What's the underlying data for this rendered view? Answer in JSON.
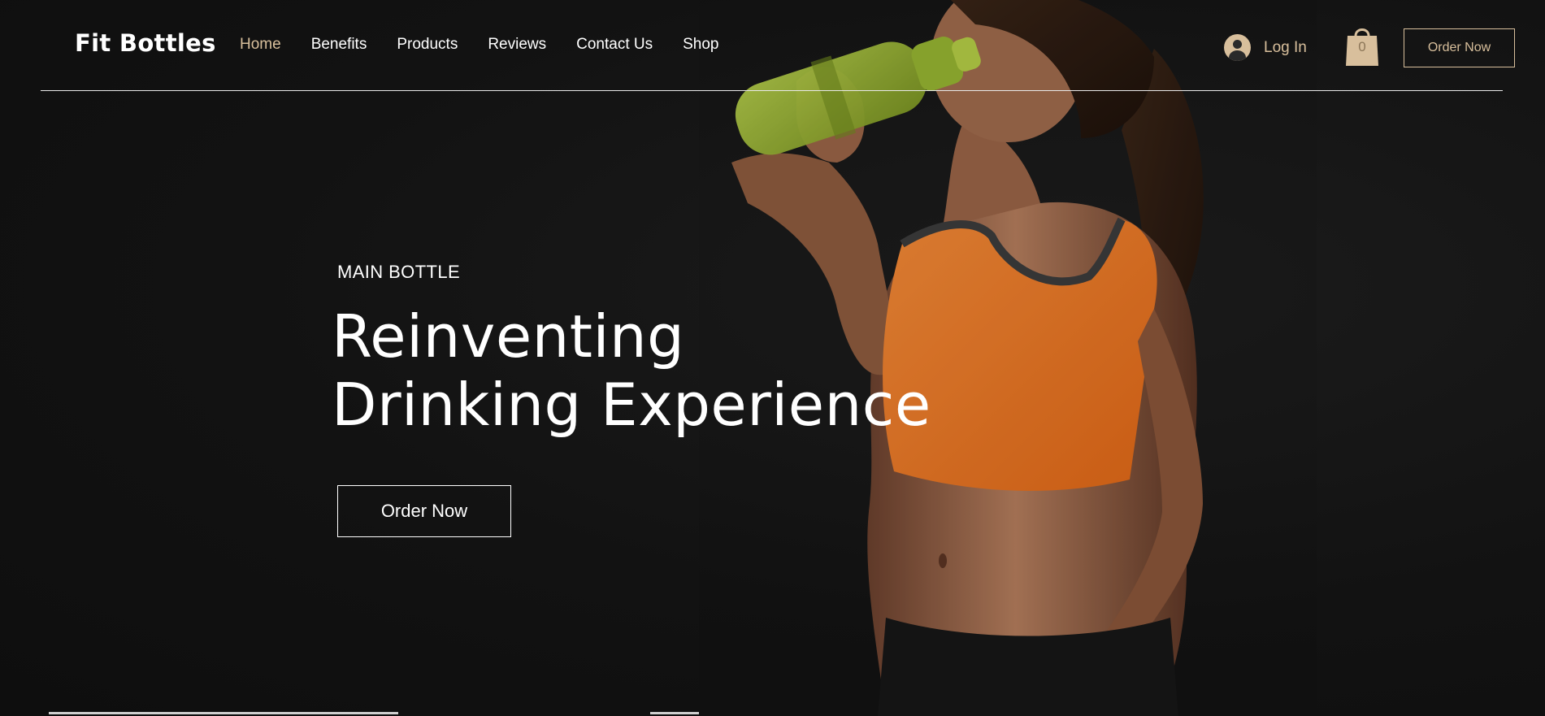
{
  "header": {
    "logo": "Fit Bottles",
    "nav": [
      {
        "label": "Home",
        "active": true
      },
      {
        "label": "Benefits"
      },
      {
        "label": "Products"
      },
      {
        "label": "Reviews"
      },
      {
        "label": "Contact Us"
      },
      {
        "label": "Shop"
      }
    ],
    "login_label": "Log In",
    "cart_count": "0",
    "order_label": "Order Now"
  },
  "hero": {
    "eyebrow": "MAIN BOTTLE",
    "headline_line1": "Reinventing",
    "headline_line2": "Drinking Experience",
    "cta_label": "Order Now"
  },
  "colors": {
    "background": "#121212",
    "accent": "#d8bf9c",
    "text": "#ffffff",
    "top_orange": "#f07a24",
    "bottle_green": "#a8c23a"
  },
  "icons": {
    "login": "user-avatar-icon",
    "cart": "shopping-bag-icon"
  }
}
